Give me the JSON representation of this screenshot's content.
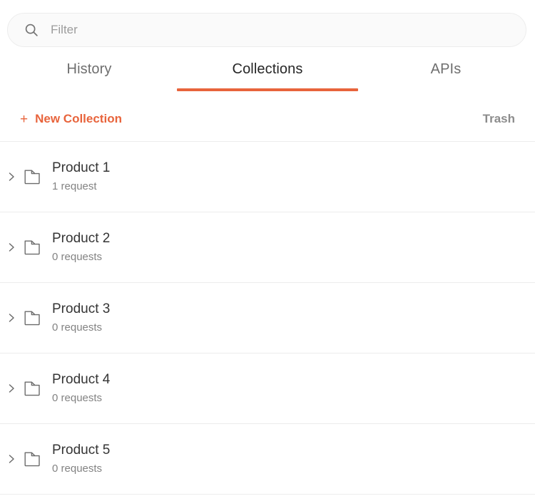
{
  "search": {
    "placeholder": "Filter",
    "value": "",
    "icon": "search-icon"
  },
  "tabs": [
    {
      "label": "History",
      "active": false
    },
    {
      "label": "Collections",
      "active": true
    },
    {
      "label": "APIs",
      "active": false
    }
  ],
  "actions": {
    "new_collection_label": "New Collection",
    "new_collection_plus": "+",
    "trash_label": "Trash"
  },
  "collections": [
    {
      "name": "Product 1",
      "requests": "1 request",
      "expand_icon": "chevron-right-icon",
      "folder_icon": "folder-icon"
    },
    {
      "name": "Product 2",
      "requests": "0 requests",
      "expand_icon": "chevron-right-icon",
      "folder_icon": "folder-icon"
    },
    {
      "name": "Product 3",
      "requests": "0 requests",
      "expand_icon": "chevron-right-icon",
      "folder_icon": "folder-icon"
    },
    {
      "name": "Product 4",
      "requests": "0 requests",
      "expand_icon": "chevron-right-icon",
      "folder_icon": "folder-icon"
    },
    {
      "name": "Product 5",
      "requests": "0 requests",
      "expand_icon": "chevron-right-icon",
      "folder_icon": "folder-icon"
    }
  ],
  "colors": {
    "accent": "#e8643c",
    "text_primary": "#343434",
    "text_secondary": "#838383",
    "divider": "#ececec",
    "search_bg": "#fafafa"
  }
}
